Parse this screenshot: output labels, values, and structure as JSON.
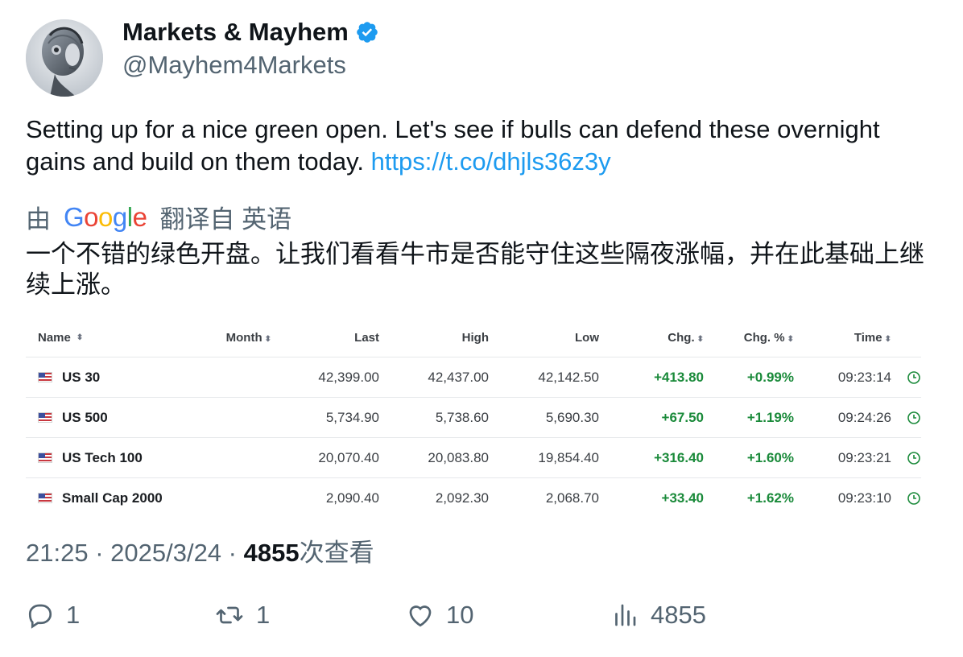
{
  "author": {
    "display_name": "Markets & Mayhem",
    "handle": "@Mayhem4Markets",
    "verified_icon": "verified-badge-icon",
    "avatar_icon": "robot-avatar"
  },
  "tweet": {
    "text": "Setting up for a nice green open. Let's see if bulls can defend these overnight gains and build on them today. ",
    "link": "https://t.co/dhjls36z3y"
  },
  "translation": {
    "prefix": "由",
    "provider": "Google",
    "suffix": "翻译自 英语",
    "text": "一个不错的绿色开盘。让我们看看牛市是否能守住这些隔夜涨幅，并在此基础上继续上涨。"
  },
  "quote_table": {
    "headers": {
      "name": "Name",
      "month": "Month",
      "last": "Last",
      "high": "High",
      "low": "Low",
      "chg": "Chg.",
      "chgp": "Chg. %",
      "time": "Time"
    },
    "rows": [
      {
        "name": "US 30",
        "last": "42,399.00",
        "high": "42,437.00",
        "low": "42,142.50",
        "chg": "+413.80",
        "chgp": "+0.99%",
        "time": "09:23:14"
      },
      {
        "name": "US 500",
        "last": "5,734.90",
        "high": "5,738.60",
        "low": "5,690.30",
        "chg": "+67.50",
        "chgp": "+1.19%",
        "time": "09:24:26"
      },
      {
        "name": "US Tech 100",
        "last": "20,070.40",
        "high": "20,083.80",
        "low": "19,854.40",
        "chg": "+316.40",
        "chgp": "+1.60%",
        "time": "09:23:21"
      },
      {
        "name": "Small Cap 2000",
        "last": "2,090.40",
        "high": "2,092.30",
        "low": "2,068.70",
        "chg": "+33.40",
        "chgp": "+1.62%",
        "time": "09:23:10"
      }
    ],
    "positive_color": "#1a8a3a"
  },
  "meta": {
    "time": "21:25",
    "sep1": " · ",
    "date": "2025/3/24",
    "sep2": " · ",
    "views": "4855",
    "views_label": "次查看"
  },
  "actions": {
    "replies": "1",
    "reposts": "1",
    "likes": "10",
    "views": "4855"
  },
  "colors": {
    "link": "#1d9bf0",
    "secondary_text": "#536471",
    "verified": "#1d9bf0"
  }
}
